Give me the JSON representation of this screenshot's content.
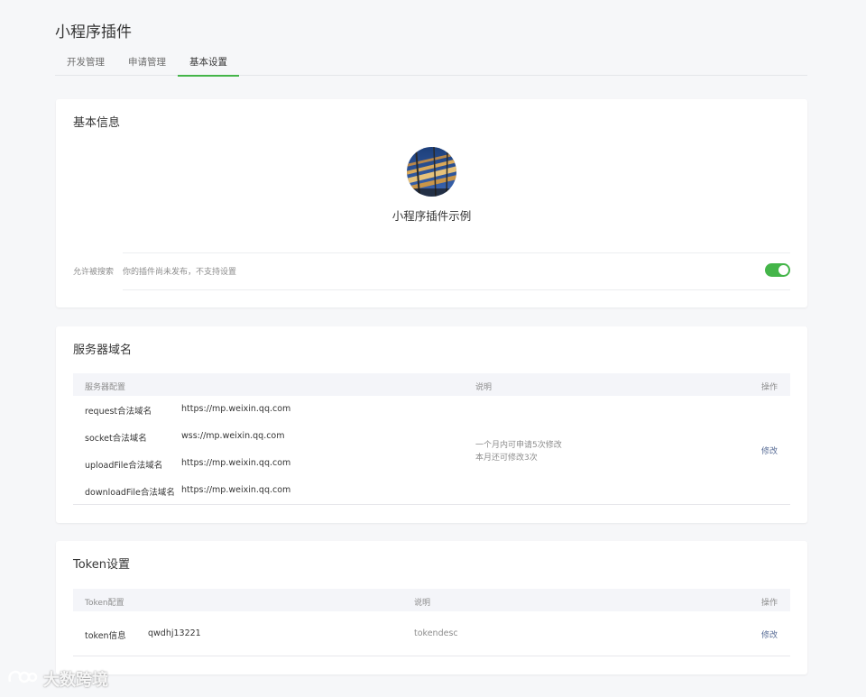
{
  "header": {
    "title": "小程序插件",
    "tabs": [
      {
        "label": "开发管理"
      },
      {
        "label": "申请管理"
      },
      {
        "label": "基本设置"
      }
    ]
  },
  "basic_info": {
    "title": "基本信息",
    "plugin_name": "小程序插件示例",
    "search_label": "允许被搜索",
    "search_desc": "你的插件尚未发布，不支持设置",
    "search_enabled": true,
    "accent_color": "#44b549"
  },
  "server_domain": {
    "title": "服务器域名",
    "headers": {
      "config": "服务器配置",
      "desc": "说明",
      "op": "操作"
    },
    "rows": [
      {
        "name": "request合法域名",
        "value": "https://mp.weixin.qq.com"
      },
      {
        "name": "socket合法域名",
        "value": "wss://mp.weixin.qq.com"
      },
      {
        "name": "uploadFile合法域名",
        "value": "https://mp.weixin.qq.com"
      },
      {
        "name": "downloadFile合法域名",
        "value": "https://mp.weixin.qq.com"
      }
    ],
    "desc_line1": "一个月内可申请5次修改",
    "desc_line2": "本月还可修改3次",
    "edit_label": "修改"
  },
  "token": {
    "title": "Token设置",
    "headers": {
      "config": "Token配置",
      "desc": "说明",
      "op": "操作"
    },
    "row": {
      "name": "token信息",
      "value": "qwdhj13221",
      "desc": "tokendesc",
      "op": "修改"
    }
  },
  "watermark": {
    "text": "大数跨境"
  }
}
